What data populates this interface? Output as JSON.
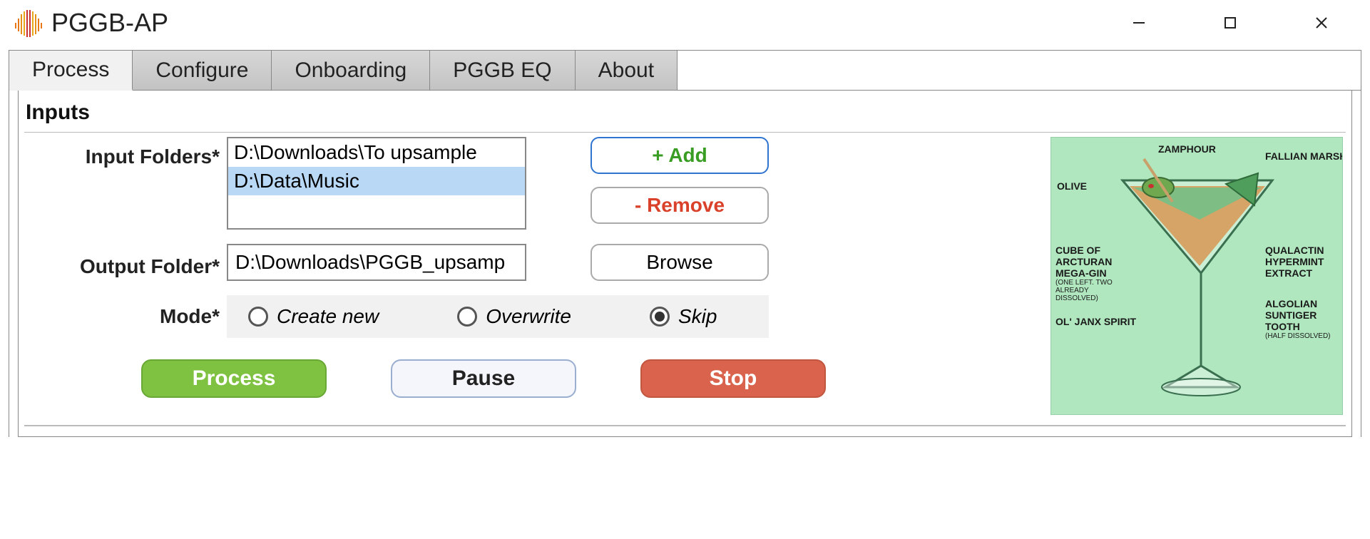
{
  "app": {
    "title": "PGGB-AP"
  },
  "window_controls": {
    "minimize": "–",
    "maximize": "□",
    "close": "✕"
  },
  "tabs": {
    "items": [
      {
        "label": "Process",
        "active": true
      },
      {
        "label": "Configure",
        "active": false
      },
      {
        "label": "Onboarding",
        "active": false
      },
      {
        "label": "PGGB EQ",
        "active": false
      },
      {
        "label": "About",
        "active": false
      }
    ]
  },
  "section": {
    "title": "Inputs"
  },
  "labels": {
    "input_folders": "Input Folders*",
    "output_folder": "Output Folder*",
    "mode": "Mode*"
  },
  "input_folders": {
    "items": [
      {
        "path": "D:\\Downloads\\To upsample",
        "selected": false
      },
      {
        "path": "D:\\Data\\Music",
        "selected": true
      }
    ]
  },
  "output_folder": {
    "value": "D:\\Downloads\\PGGB_upsamp"
  },
  "buttons": {
    "add": "+ Add",
    "remove": "- Remove",
    "browse": "Browse",
    "process": "Process",
    "pause": "Pause",
    "stop": "Stop"
  },
  "mode": {
    "options": [
      {
        "label": "Create new",
        "checked": false
      },
      {
        "label": "Overwrite",
        "checked": false
      },
      {
        "label": "Skip",
        "checked": true
      }
    ]
  },
  "illustration": {
    "annotations": {
      "olive": "OLIVE",
      "zamphour": "ZAMPHOUR",
      "fallian": "FALLIAN MARSH GAS",
      "cube": "CUBE OF ARCTURAN MEGA-GIN",
      "cube_sub": "(ONE LEFT. TWO ALREADY DISSOLVED)",
      "qualactin": "QUALACTIN HYPERMINT EXTRACT",
      "janx": "OL' JANX SPIRIT",
      "algolian": "ALGOLIAN SUNTIGER TOOTH",
      "algolian_sub": "(HALF DISSOLVED)"
    }
  }
}
